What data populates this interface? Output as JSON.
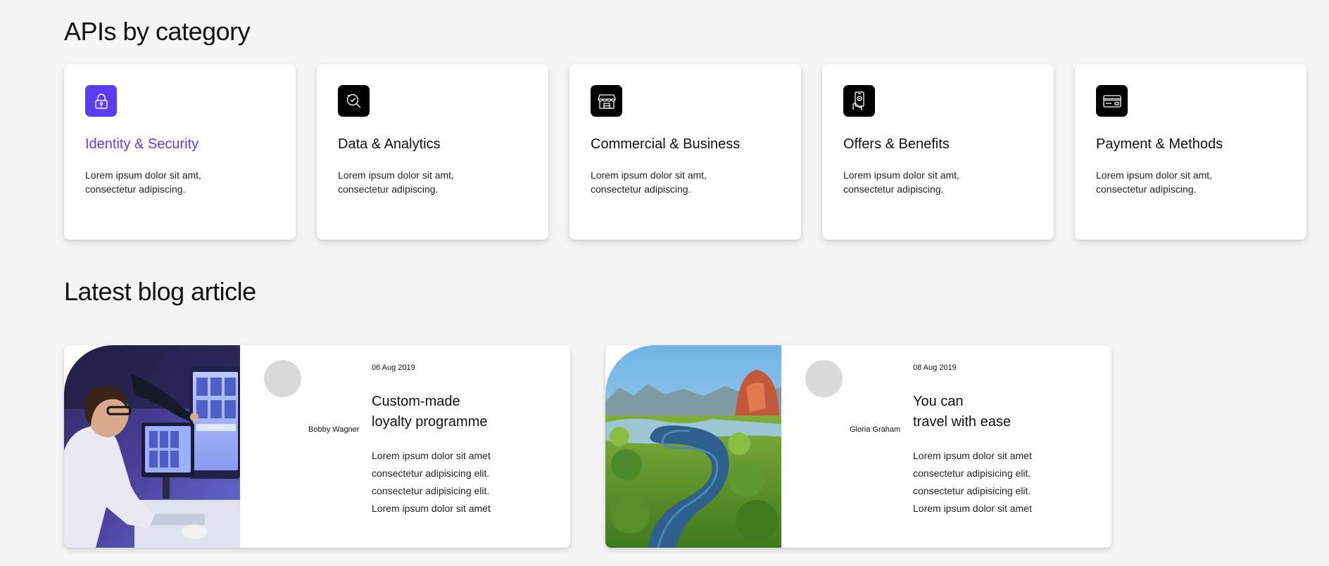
{
  "sections": {
    "apis_title": "APIs by category",
    "blog_title": "Latest blog article"
  },
  "categories": [
    {
      "icon": "lock-icon",
      "title": "Identity & Security",
      "desc_line1": "Lorem ipsum dolor sit amt,",
      "desc_line2": "consectetur adipiscing."
    },
    {
      "icon": "analytics-search-icon",
      "title": "Data & Analytics",
      "desc_line1": "Lorem ipsum dolor sit amt,",
      "desc_line2": "consectetur adipiscing."
    },
    {
      "icon": "storefront-icon",
      "title": "Commercial & Business",
      "desc_line1": "Lorem ipsum dolor sit amt,",
      "desc_line2": "consectetur adipiscing."
    },
    {
      "icon": "mobile-offer-icon",
      "title": "Offers & Benefits",
      "desc_line1": "Lorem ipsum dolor sit amt,",
      "desc_line2": "consectetur adipiscing."
    },
    {
      "icon": "credit-card-icon",
      "title": "Payment & Methods",
      "desc_line1": "Lorem ipsum dolor sit amt,",
      "desc_line2": "consectetur adipiscing."
    }
  ],
  "blog": [
    {
      "date": "06 Aug 2019",
      "author": "Bobby Wagner",
      "title_line1": "Custom-made",
      "title_line2": "loyalty programme",
      "excerpt": [
        "Lorem ipsum dolor sit amet",
        "consectetur adipisicing elit.",
        "consectetur adipisicing elit.",
        "Lorem ipsum dolor sit amet"
      ]
    },
    {
      "date": "08 Aug 2019",
      "author": "Gloria Graham",
      "title_line1": "You can",
      "title_line2": "travel with ease",
      "excerpt": [
        "Lorem ipsum dolor sit amet",
        "consectetur adipisicing elit.",
        "consectetur adipisicing elit.",
        "Lorem ipsum dolor sit amet"
      ]
    }
  ],
  "colors": {
    "accent": "#5a3cf6",
    "background": "#f5f5f5",
    "card": "#ffffff",
    "icon_bg": "#000000"
  }
}
